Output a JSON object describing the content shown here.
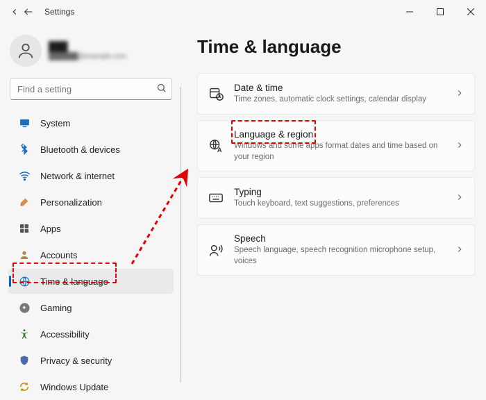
{
  "window": {
    "title": "Settings"
  },
  "user": {
    "name": "███",
    "sub": "██████@example.com"
  },
  "search": {
    "placeholder": "Find a setting"
  },
  "sidebar": {
    "items": [
      {
        "label": "System"
      },
      {
        "label": "Bluetooth & devices"
      },
      {
        "label": "Network & internet"
      },
      {
        "label": "Personalization"
      },
      {
        "label": "Apps"
      },
      {
        "label": "Accounts"
      },
      {
        "label": "Time & language"
      },
      {
        "label": "Gaming"
      },
      {
        "label": "Accessibility"
      },
      {
        "label": "Privacy & security"
      },
      {
        "label": "Windows Update"
      }
    ]
  },
  "page": {
    "title": "Time & language",
    "cards": [
      {
        "title": "Date & time",
        "sub": "Time zones, automatic clock settings, calendar display"
      },
      {
        "title": "Language & region",
        "sub": "Windows and some apps format dates and time based on your region"
      },
      {
        "title": "Typing",
        "sub": "Touch keyboard, text suggestions, preferences"
      },
      {
        "title": "Speech",
        "sub": "Speech language, speech recognition microphone setup, voices"
      }
    ]
  },
  "colors": {
    "accent": "#0067c0",
    "annotation": "#e20000"
  }
}
